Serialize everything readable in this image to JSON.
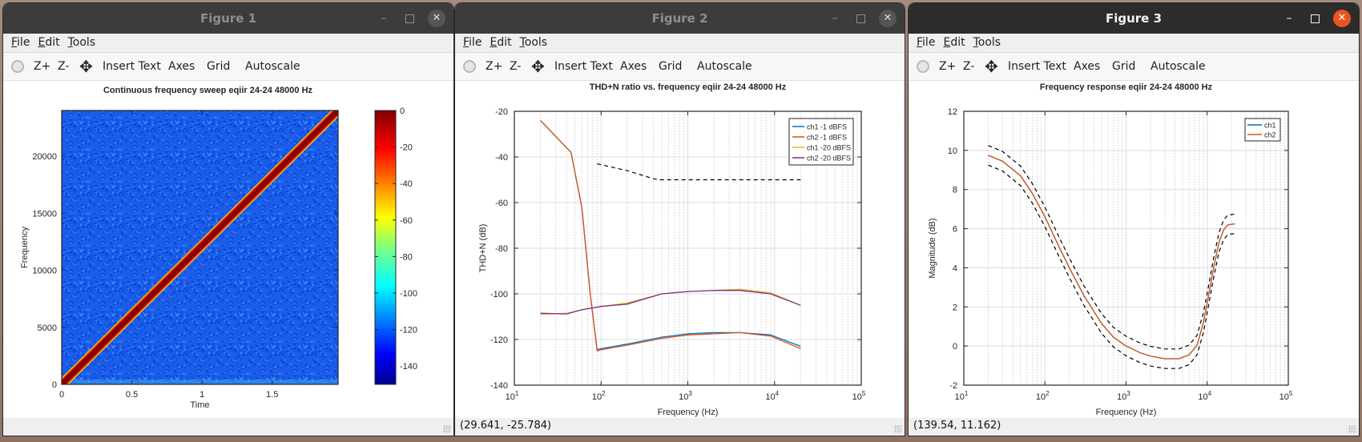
{
  "windows": [
    {
      "title": "Figure 1",
      "active": false,
      "menu": [
        "File",
        "Edit",
        "Tools"
      ],
      "toolbar": [
        "Z+",
        "Z-",
        "Insert Text",
        "Axes",
        "Grid",
        "Autoscale"
      ],
      "status": ""
    },
    {
      "title": "Figure 2",
      "active": false,
      "menu": [
        "File",
        "Edit",
        "Tools"
      ],
      "toolbar": [
        "Z+",
        "Z-",
        "Insert Text",
        "Axes",
        "Grid",
        "Autoscale"
      ],
      "status": "(29.641, -25.784)"
    },
    {
      "title": "Figure 3",
      "active": true,
      "menu": [
        "File",
        "Edit",
        "Tools"
      ],
      "toolbar": [
        "Z+",
        "Z-",
        "Insert Text",
        "Axes",
        "Grid",
        "Autoscale"
      ],
      "status": "(139.54, 11.162)"
    }
  ],
  "icons": {
    "rotate": "rotate-icon",
    "pan": "pan-icon",
    "minimize": "minimize-icon",
    "maximize": "maximize-icon",
    "close": "close-icon"
  },
  "colors": {
    "ch1": "#0072bd",
    "ch2": "#d95319",
    "ch1_20": "#edb120",
    "ch2_20": "#7e2f8e",
    "limit": "#000000",
    "active_close": "#e95420"
  },
  "chart_data": [
    {
      "type": "heatmap",
      "title": "Continuous frequency sweep eqiir 24-24 48000 Hz",
      "xlabel": "Time",
      "ylabel": "Frequency",
      "xlim": [
        0,
        1.97
      ],
      "ylim": [
        0,
        24000
      ],
      "xticks": [
        0,
        0.5,
        1,
        1.5
      ],
      "xtick_labels": [
        "0",
        "0.5",
        "1",
        "1.5"
      ],
      "yticks": [
        0,
        5000,
        10000,
        15000,
        20000
      ],
      "ytick_labels": [
        "0",
        "5000",
        "10000",
        "15000",
        "20000"
      ],
      "colorbar": {
        "range": [
          -150,
          0
        ],
        "ticks": [
          0,
          -20,
          -40,
          -60,
          -80,
          -100,
          -120,
          -140
        ],
        "tick_labels": [
          "0",
          "-20",
          "-40",
          "-60",
          "-80",
          "-100",
          "-120",
          "-140"
        ],
        "colormap": "jet"
      },
      "sweep": {
        "t_start": 0,
        "f_start": 0,
        "t_end": 1.97,
        "f_end": 24000,
        "level_db": 0
      },
      "noise_floor_db": -120
    },
    {
      "type": "line",
      "title": "THD+N ratio vs. frequency eqiir 24-24 48000 Hz",
      "xlabel": "Frequency (Hz)",
      "ylabel": "THD+N (dB)",
      "xscale": "log",
      "xlim": [
        10,
        100000
      ],
      "ylim": [
        -140,
        -20
      ],
      "xticks": [
        10,
        100,
        1000,
        10000,
        100000
      ],
      "xtick_labels": [
        [
          "10",
          "1"
        ],
        [
          "10",
          "2"
        ],
        [
          "10",
          "3"
        ],
        [
          "10",
          "4"
        ],
        [
          "10",
          "5"
        ]
      ],
      "yticks": [
        -20,
        -40,
        -60,
        -80,
        -100,
        -120,
        -140
      ],
      "ytick_labels": [
        "-20",
        "-40",
        "-60",
        "-80",
        "-100",
        "-120",
        "-140"
      ],
      "grid": true,
      "legend": "top-right",
      "series": [
        {
          "name": "ch1  -1 dBFS",
          "color": "#0072bd",
          "x": [
            20,
            40,
            45,
            60,
            75,
            90,
            100,
            200,
            500,
            1000,
            2000,
            4000,
            9000,
            20000
          ],
          "y": [
            -24,
            -36,
            -38,
            -62,
            -100,
            -124.5,
            -124,
            -122,
            -119,
            -117.5,
            -117,
            -117,
            -118,
            -123
          ]
        },
        {
          "name": "ch2  -1 dBFS",
          "color": "#d95319",
          "x": [
            20,
            40,
            45,
            60,
            75,
            90,
            100,
            200,
            500,
            1000,
            2000,
            4000,
            9000,
            20000
          ],
          "y": [
            -24,
            -36,
            -38,
            -62,
            -100,
            -125,
            -124.5,
            -122.5,
            -119.5,
            -118,
            -117.5,
            -117,
            -118.5,
            -124
          ]
        },
        {
          "name": "ch1 -20 dBFS",
          "color": "#edb120",
          "x": [
            20,
            40,
            60,
            100,
            200,
            500,
            1000,
            2000,
            4000,
            9000,
            20000
          ],
          "y": [
            -109,
            -108.5,
            -107,
            -105.5,
            -104,
            -100,
            -99,
            -98.5,
            -98,
            -99.5,
            -105
          ]
        },
        {
          "name": "ch2 -20 dBFS",
          "color": "#7e2f8e",
          "x": [
            20,
            40,
            60,
            100,
            200,
            500,
            1000,
            2000,
            4000,
            9000,
            20000
          ],
          "y": [
            -108.5,
            -108.8,
            -107,
            -105.5,
            -104.5,
            -100,
            -99,
            -98.5,
            -98.5,
            -100,
            -105
          ]
        },
        {
          "name": "limit",
          "color": "#000000",
          "dashed": true,
          "in_legend": false,
          "x": [
            90,
            200,
            400,
            450,
            1000,
            5000,
            20000
          ],
          "y": [
            -43,
            -46,
            -49.5,
            -50,
            -50,
            -50,
            -50
          ]
        }
      ]
    },
    {
      "type": "line",
      "title": "Frequency response eqiir 24-24 48000 Hz",
      "xlabel": "Frequency (Hz)",
      "ylabel": "Magnitude (dB)",
      "xscale": "log",
      "xlim": [
        10,
        100000
      ],
      "ylim": [
        -2,
        12
      ],
      "xticks": [
        10,
        100,
        1000,
        10000,
        100000
      ],
      "xtick_labels": [
        [
          "10",
          "1"
        ],
        [
          "10",
          "2"
        ],
        [
          "10",
          "3"
        ],
        [
          "10",
          "4"
        ],
        [
          "10",
          "5"
        ]
      ],
      "yticks": [
        12,
        10,
        8,
        6,
        4,
        2,
        0,
        -2
      ],
      "ytick_labels": [
        "12",
        "10",
        "8",
        "6",
        "4",
        "2",
        "0",
        "-2"
      ],
      "grid": true,
      "legend": "top-right",
      "series": [
        {
          "name": "ch1",
          "color": "#0072bd",
          "x": [
            20,
            30,
            50,
            70,
            100,
            150,
            200,
            300,
            500,
            700,
            1000,
            1500,
            2000,
            3000,
            4500,
            6000,
            7500,
            9000,
            10000,
            12000,
            14000,
            16000,
            18000,
            22000
          ],
          "y": [
            9.75,
            9.45,
            8.7,
            7.8,
            6.6,
            5.05,
            4.0,
            2.6,
            1.15,
            0.45,
            0.0,
            -0.35,
            -0.52,
            -0.65,
            -0.65,
            -0.45,
            0.05,
            1.2,
            2.2,
            4.0,
            5.3,
            5.95,
            6.2,
            6.25
          ]
        },
        {
          "name": "ch2",
          "color": "#d95319",
          "x": [
            20,
            30,
            50,
            70,
            100,
            150,
            200,
            300,
            500,
            700,
            1000,
            1500,
            2000,
            3000,
            4500,
            6000,
            7500,
            9000,
            10000,
            12000,
            14000,
            16000,
            18000,
            22000
          ],
          "y": [
            9.75,
            9.45,
            8.7,
            7.8,
            6.6,
            5.05,
            4.0,
            2.6,
            1.15,
            0.45,
            0.0,
            -0.35,
            -0.52,
            -0.65,
            -0.65,
            -0.45,
            0.05,
            1.2,
            2.2,
            4.0,
            5.3,
            5.95,
            6.2,
            6.25
          ]
        },
        {
          "name": "upper limit",
          "color": "#000000",
          "dashed": true,
          "in_legend": false,
          "offset": 0.5
        },
        {
          "name": "lower limit",
          "color": "#000000",
          "dashed": true,
          "in_legend": false,
          "offset": -0.5
        }
      ]
    }
  ]
}
